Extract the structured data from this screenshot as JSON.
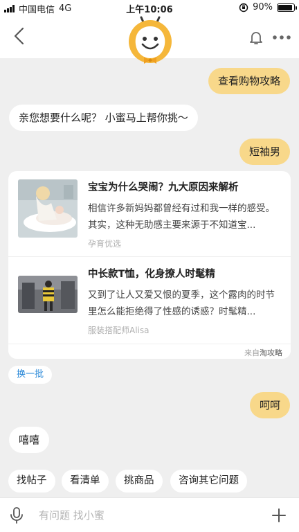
{
  "status_bar": {
    "carrier": "中国电信",
    "network": "4G",
    "time": "上午10:06",
    "battery_percent": "90%",
    "battery_level": 0.9
  },
  "nav": {
    "back_icon": "chevron-left-icon",
    "mascot": "bee-mascot-avatar",
    "bell_icon": "bell-icon",
    "more_icon": "more-dots-icon"
  },
  "messages": {
    "m1_user": "查看购物攻略",
    "m2_bot": "亲您想要什么呢？ 小蜜马上帮你挑～",
    "m3_user": "短袖男",
    "m4_user": "呵呵",
    "m5_bot": "嘻嘻"
  },
  "card": {
    "articles": [
      {
        "title": "宝宝为什么哭闹？九大原因来解析",
        "summary": "相信许多新妈妈都曾经有过和我一样的感受。其实，这种无助感主要来源于不知道宝...",
        "source": "孕育优选"
      },
      {
        "title": "中长款T恤，化身撩人时髦精",
        "summary": "又到了让人又爱又恨的夏季，这个露肉的时节里怎么能拒绝得了性感的诱惑？时髦精...",
        "source": "服装搭配师Alisa"
      }
    ],
    "footer_prefix": "来自",
    "footer_source": "淘攻略"
  },
  "refresh_label": "换一批",
  "chips": [
    "找帖子",
    "看清单",
    "挑商品",
    "咨询其它问题"
  ],
  "input": {
    "placeholder": "有问题 找小蜜",
    "value": ""
  },
  "colors": {
    "user_bubble": "#f8d88a",
    "link_blue": "#2a88d8",
    "background": "#efefef"
  }
}
